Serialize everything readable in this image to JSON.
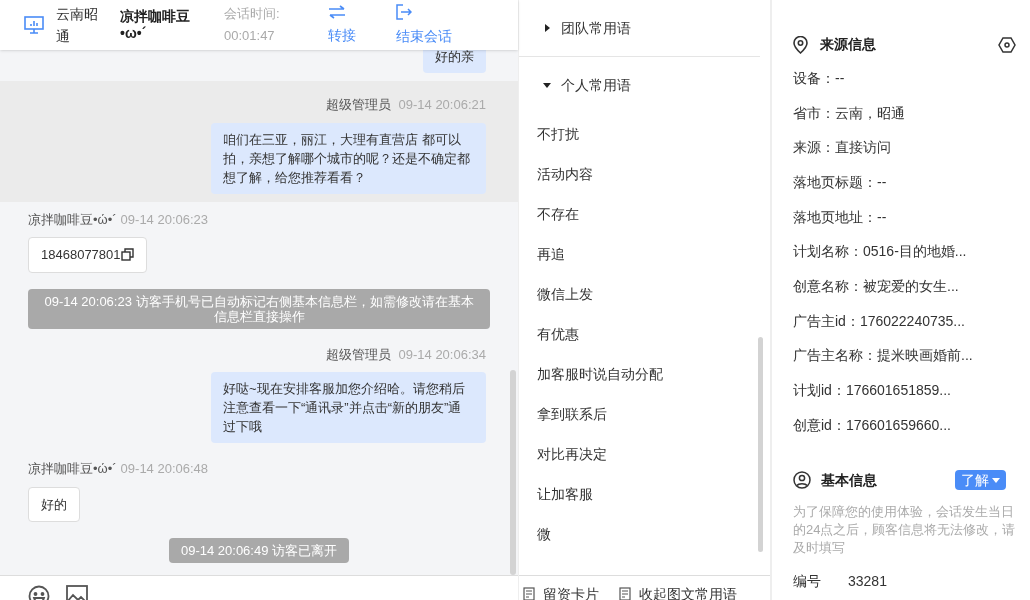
{
  "header": {
    "location": "云南昭通",
    "visitor_name": "凉拌咖啡豆•ω•´",
    "duration_label": "会话时间:",
    "duration": "00:01:47",
    "actions": [
      {
        "kind": "transfer",
        "label": "转接"
      },
      {
        "kind": "end",
        "label": "结束会话"
      }
    ]
  },
  "messages": [
    {
      "kind": "agent",
      "text": "好的亲",
      "highlighted": false
    },
    {
      "kind": "agent",
      "sender": "超级管理员",
      "time": "09-14 20:06:21",
      "text": "咱们在三亚，丽江，大理有直营店 都可以拍，亲想了解哪个城市的呢？还是不确定都想了解，给您推荐看看？",
      "highlighted": true
    },
    {
      "kind": "visitor",
      "sender": "凉拌咖啡豆•ώ•´",
      "time": "09-14 20:06:23",
      "text": "18468077801",
      "copyable": true,
      "highlighted": false
    },
    {
      "kind": "system",
      "text": "09-14 20:06:23 访客手机号已自动标记右侧基本信息栏，如需修改请在基本信息栏直接操作",
      "highlighted": false
    },
    {
      "kind": "agent",
      "sender": "超级管理员",
      "time": "09-14 20:06:34",
      "text": "好哒~现在安排客服加您介绍哈。请您稍后注意查看一下“通讯录”并点击“新的朋友”通过下哦",
      "highlighted": false
    },
    {
      "kind": "visitor",
      "sender": "凉拌咖啡豆•ώ•´",
      "time": "09-14 20:06:48",
      "text": "好的",
      "copyable": false,
      "highlighted": false
    },
    {
      "kind": "system",
      "text": "09-14 20:06:49 访客已离开",
      "highlighted": false
    }
  ],
  "composer_tools": [
    {
      "kind": "emoji"
    },
    {
      "kind": "image"
    }
  ],
  "phrase_groups": [
    {
      "title": "团队常用语",
      "expanded": false
    },
    {
      "title": "个人常用语",
      "expanded": true,
      "items": [
        "不打扰",
        "活动内容",
        "不存在",
        "再追",
        "微信上发",
        "有优惠",
        "加客服时说自动分配",
        "拿到联系后",
        "对比再决定",
        "让加客服",
        "微"
      ]
    }
  ],
  "phrase_actions": [
    "留资卡片",
    "收起图文常用语"
  ],
  "source_info": {
    "title": "来源信息",
    "rows": [
      "设备：--",
      "省市：云南，昭通",
      "来源：直接访问",
      "落地页标题：--",
      "落地页地址：--",
      "计划名称：0516-目的地婚...",
      "创意名称：被宠爱的女生...",
      "广告主id：176022240735...",
      "广告主名称：提米映画婚前...",
      "计划id：176601651859...",
      "创意id：176601659660..."
    ]
  },
  "basic_info": {
    "title": "基本信息",
    "button": "了解",
    "notice": "为了保障您的使用体验，会话发生当日的24点之后，顾客信息将无法修改，请及时填写",
    "fields": [
      {
        "label": "编号",
        "value": "33281"
      }
    ]
  }
}
